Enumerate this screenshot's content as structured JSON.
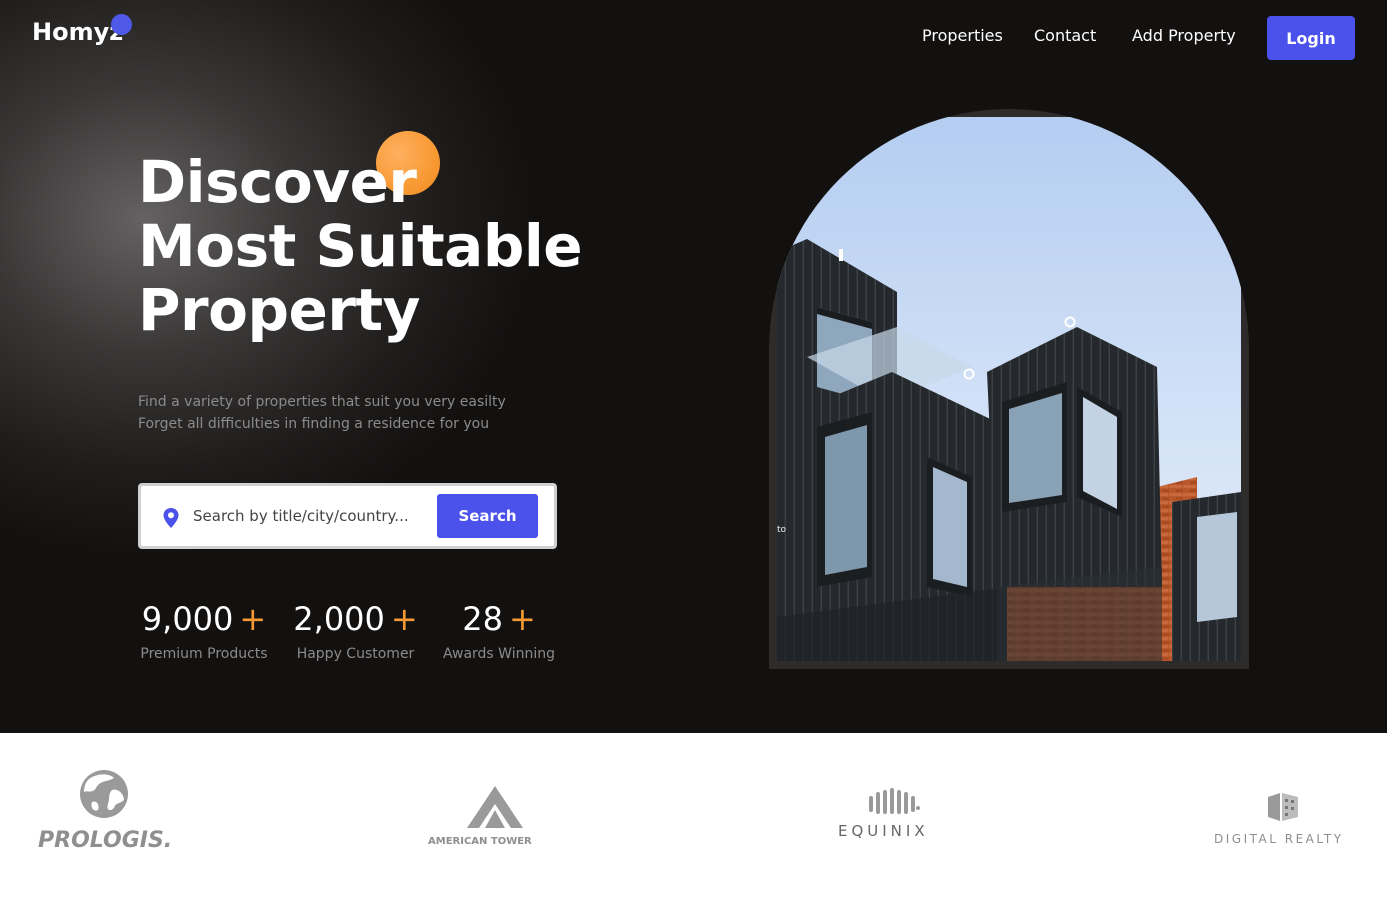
{
  "header": {
    "logo": "Homyz",
    "nav": [
      "Properties",
      "Contact",
      "Add Property"
    ],
    "login_label": "Login"
  },
  "hero": {
    "title_lines": [
      "Discover",
      "Most Suitable",
      "Property"
    ],
    "description_lines": [
      "Find a variety of properties that suit you very easilty",
      "Forget all difficulties in finding a residence for you"
    ],
    "search": {
      "placeholder": "Search by title/city/country...",
      "button_label": "Search",
      "icon": "location-pin-icon"
    },
    "stats": [
      {
        "value": "9,000",
        "suffix": "+",
        "label": "Premium Products"
      },
      {
        "value": "2,000",
        "suffix": "+",
        "label": "Happy Customer"
      },
      {
        "value": "28",
        "suffix": "+",
        "label": "Awards Winning"
      }
    ],
    "image_caption_fragment": "to"
  },
  "companies": [
    "PROLOGIS.",
    "AMERICAN TOWER",
    "EQUINIX",
    "DIGITAL REALTY"
  ],
  "colors": {
    "background": "#131110",
    "accent": "#4b52ec",
    "orange": "#f89a34",
    "muted_text": "#8b8b8b"
  }
}
